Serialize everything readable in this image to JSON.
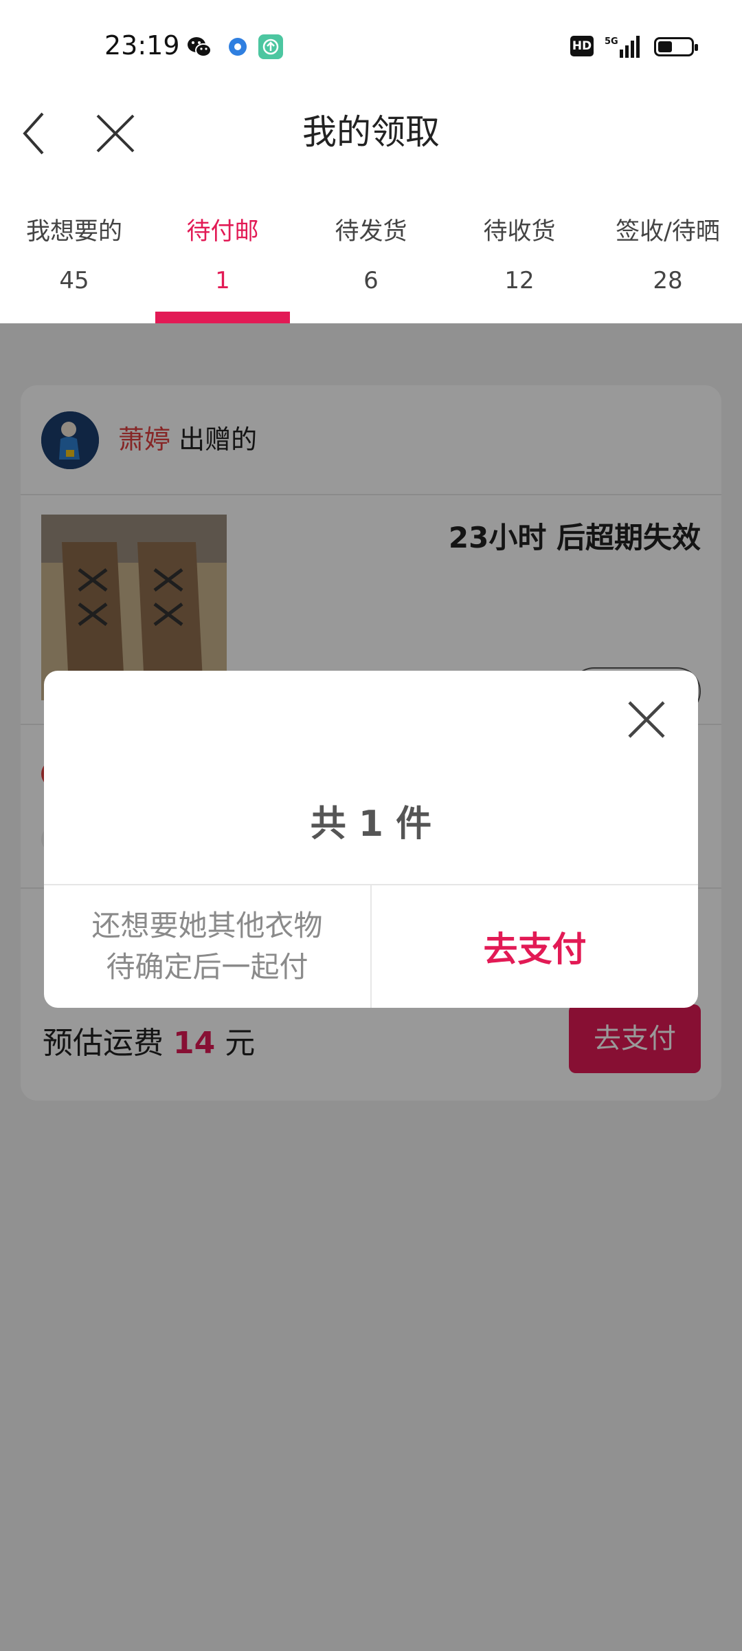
{
  "status_bar": {
    "time": "23:19",
    "network": "5G",
    "hd_badge": "HD"
  },
  "header": {
    "title": "我的领取"
  },
  "tabs": [
    {
      "label": "我想要的",
      "count": "45",
      "active": false
    },
    {
      "label": "待付邮",
      "count": "1",
      "active": true
    },
    {
      "label": "待发货",
      "count": "6",
      "active": false
    },
    {
      "label": "待收货",
      "count": "12",
      "active": false
    },
    {
      "label": "签收/待晒",
      "count": "28",
      "active": false
    }
  ],
  "card": {
    "giver_name": "萧婷",
    "giver_suffix": "出赠的",
    "expiry_text": "23小时 后超期失效",
    "shipping_prefix": "预估运费",
    "shipping_amount": "14",
    "shipping_unit": "元",
    "pay_button": "去支付"
  },
  "modal": {
    "title": "共 1 件",
    "left_line1": "还想要她其他衣物",
    "left_line2": "待确定后一起付",
    "right_button": "去支付"
  },
  "colors": {
    "accent": "#e21a55",
    "overlay": "rgba(0,0,0,0.4)"
  }
}
